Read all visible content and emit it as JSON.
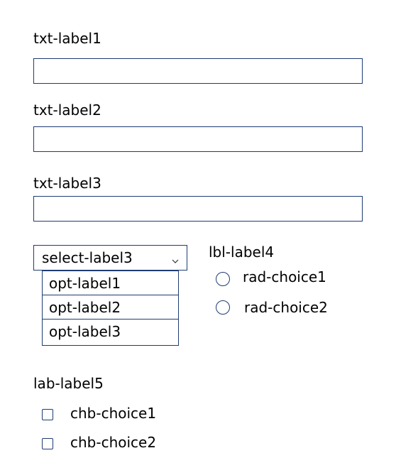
{
  "fields": {
    "txt1": {
      "label": "txt-label1",
      "value": ""
    },
    "txt2": {
      "label": "txt-label2",
      "value": ""
    },
    "txt3": {
      "label": "txt-label3",
      "value": ""
    }
  },
  "select": {
    "selected": "select-label3",
    "options": [
      "opt-label1",
      "opt-label2",
      "opt-label3"
    ]
  },
  "radio_group": {
    "label": "lbl-label4",
    "choices": [
      "rad-choice1",
      "rad-choice2"
    ]
  },
  "checkbox_group": {
    "label": "lab-label5",
    "choices": [
      "chb-choice1",
      "chb-choice2"
    ]
  },
  "icons": {
    "select_chevron": "chevron-down-icon",
    "radio": "radio-circle",
    "checkbox": "checkbox-square"
  },
  "colors": {
    "border": "#1f3b73",
    "text": "#000000",
    "background": "#ffffff"
  }
}
